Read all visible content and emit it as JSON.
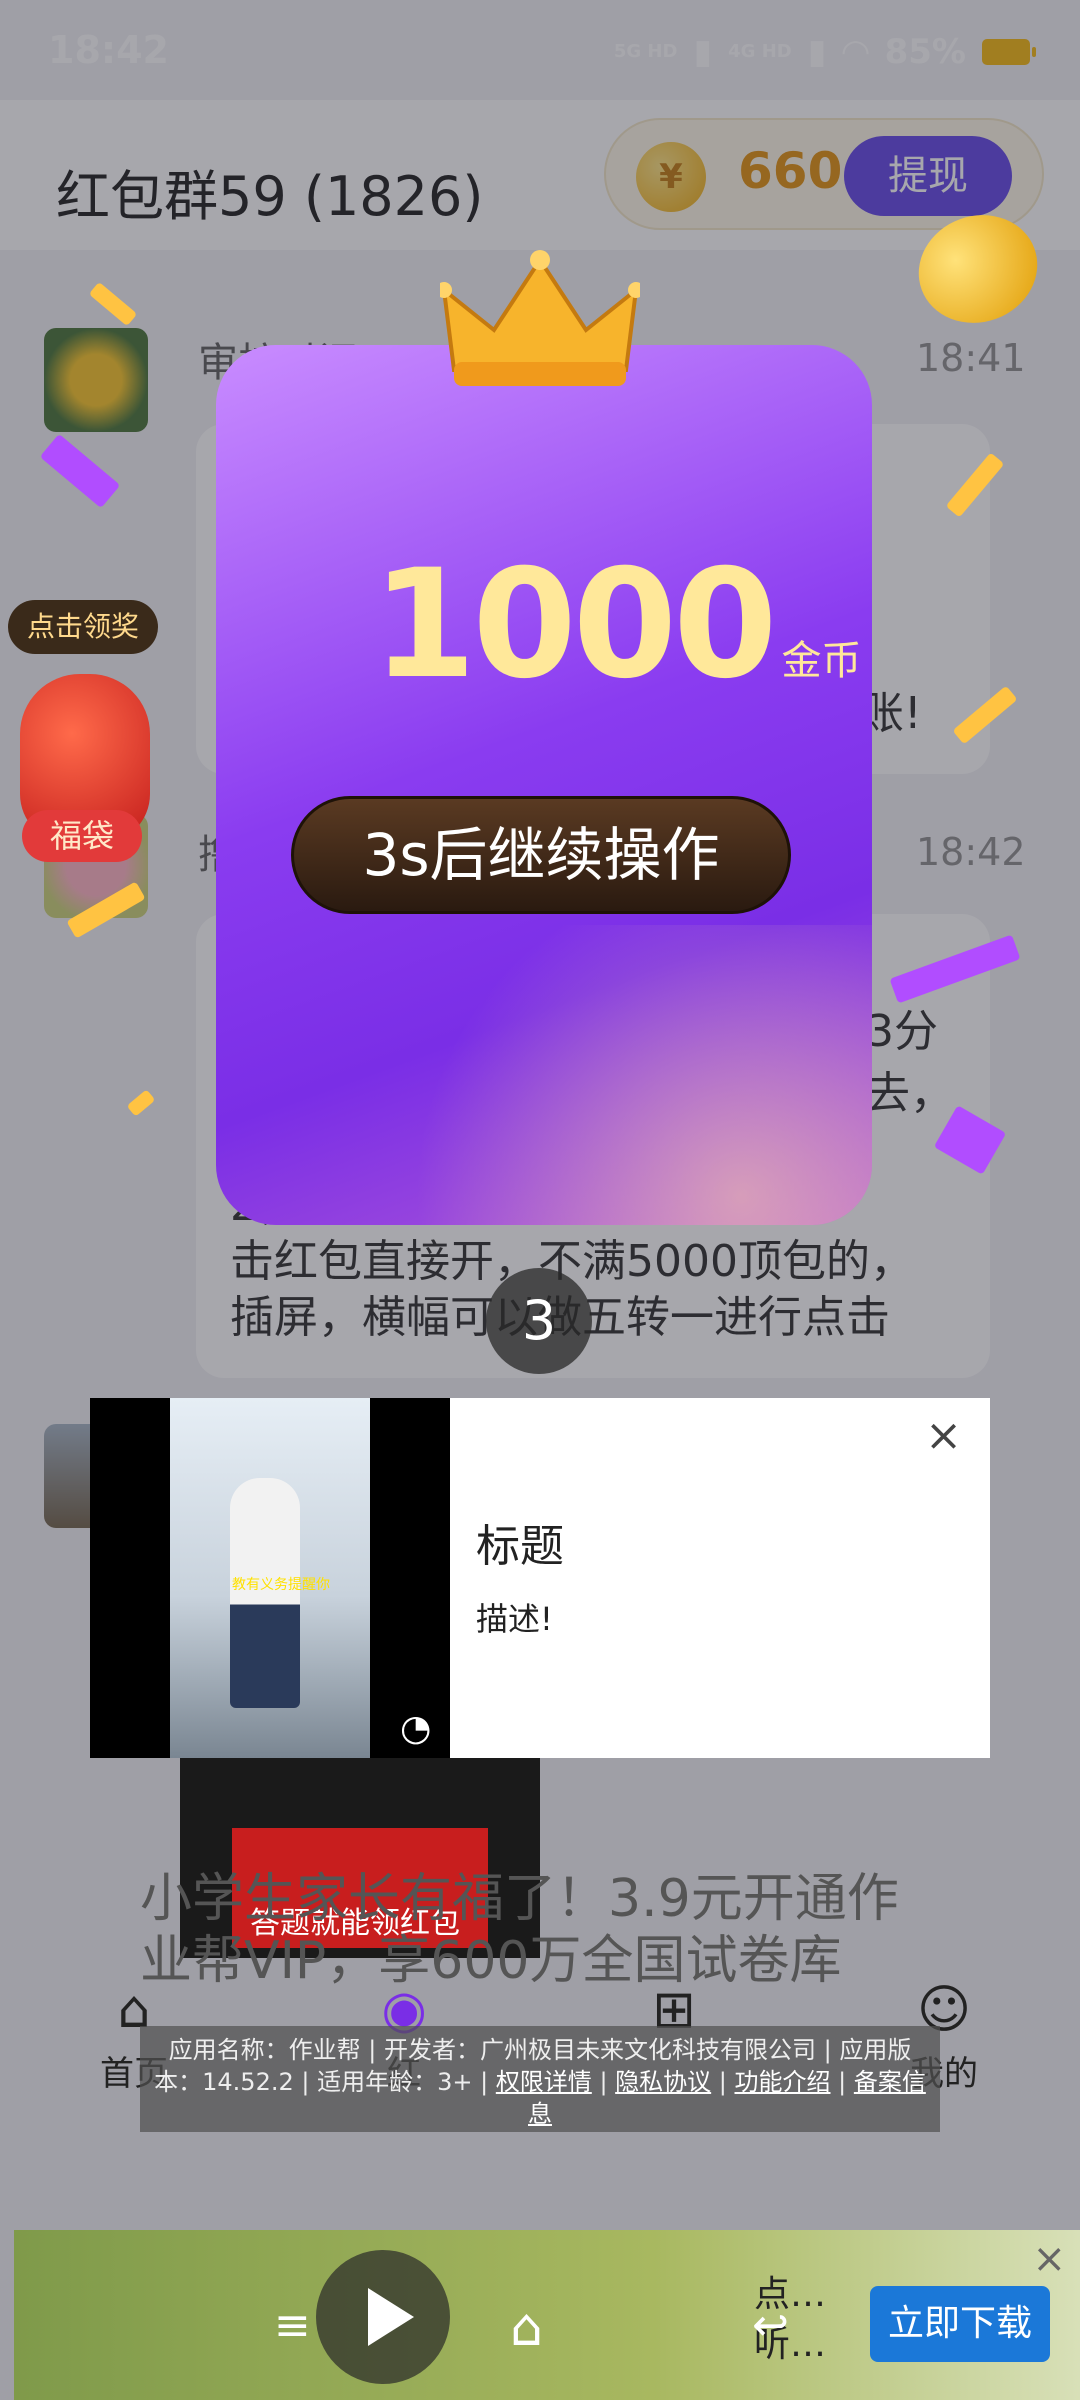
{
  "status": {
    "time": "18:42",
    "net1": "5G HD",
    "net2": "4G HD",
    "battery": "85%"
  },
  "header": {
    "title": "红包群59 (1826)",
    "coin_icon": "¥",
    "coin_count": "660",
    "withdraw_label": "提现"
  },
  "chat": [
    {
      "name": "审核时间",
      "time": "18:41"
    },
    {
      "name": "撸",
      "time": "18:42"
    }
  ],
  "chat_text": {
    "fragment_a": "账!",
    "fragment_b": "3分",
    "fragment_c": "去，",
    "line1": "2，            来点",
    "line2": "击红包直接开，不满5000顶包的，",
    "line3": "插屏，横幅可以做五转一进行点击"
  },
  "reward": {
    "amount": "1000",
    "unit": "金币",
    "cta": "3s后继续操作",
    "countdown": "3"
  },
  "ad_popup": {
    "title": "标题",
    "desc": "描述!",
    "video_caption": "教有义务提醒你",
    "close": "×"
  },
  "lower": {
    "article": "小学生家长有福了！3.9元开通作业帮VIP，享600万全国试卷库",
    "video_caption": "答题就能领红包",
    "appinfo_prefix": "应用名称：作业帮 | 开发者：广州极目未来文化科技有限公司 | 应用版本：14.52.2 | 适用年龄：3+ | ",
    "link_perm": "权限详情",
    "link_privacy": "隐私协议",
    "link_func": "功能介绍",
    "link_record": "备案信息"
  },
  "nav": [
    {
      "label": "首页",
      "icon": "home-icon"
    },
    {
      "label": "红",
      "icon": "redpacket-icon"
    },
    {
      "label": "",
      "icon": "gift-icon"
    },
    {
      "label": "我的",
      "icon": "user-icon"
    }
  ],
  "bottom_ad": {
    "side_line1": "点…",
    "side_line2": "听…",
    "download": "立即下载",
    "close": "×"
  },
  "bag": {
    "tip": "点击领奖",
    "label": "福袋"
  },
  "colors": {
    "accent": "#5a3be6",
    "coin": "#e08a00",
    "card_purple": "#8a3cf0",
    "reward_text": "#ffe89a",
    "download": "#1b78d8"
  }
}
